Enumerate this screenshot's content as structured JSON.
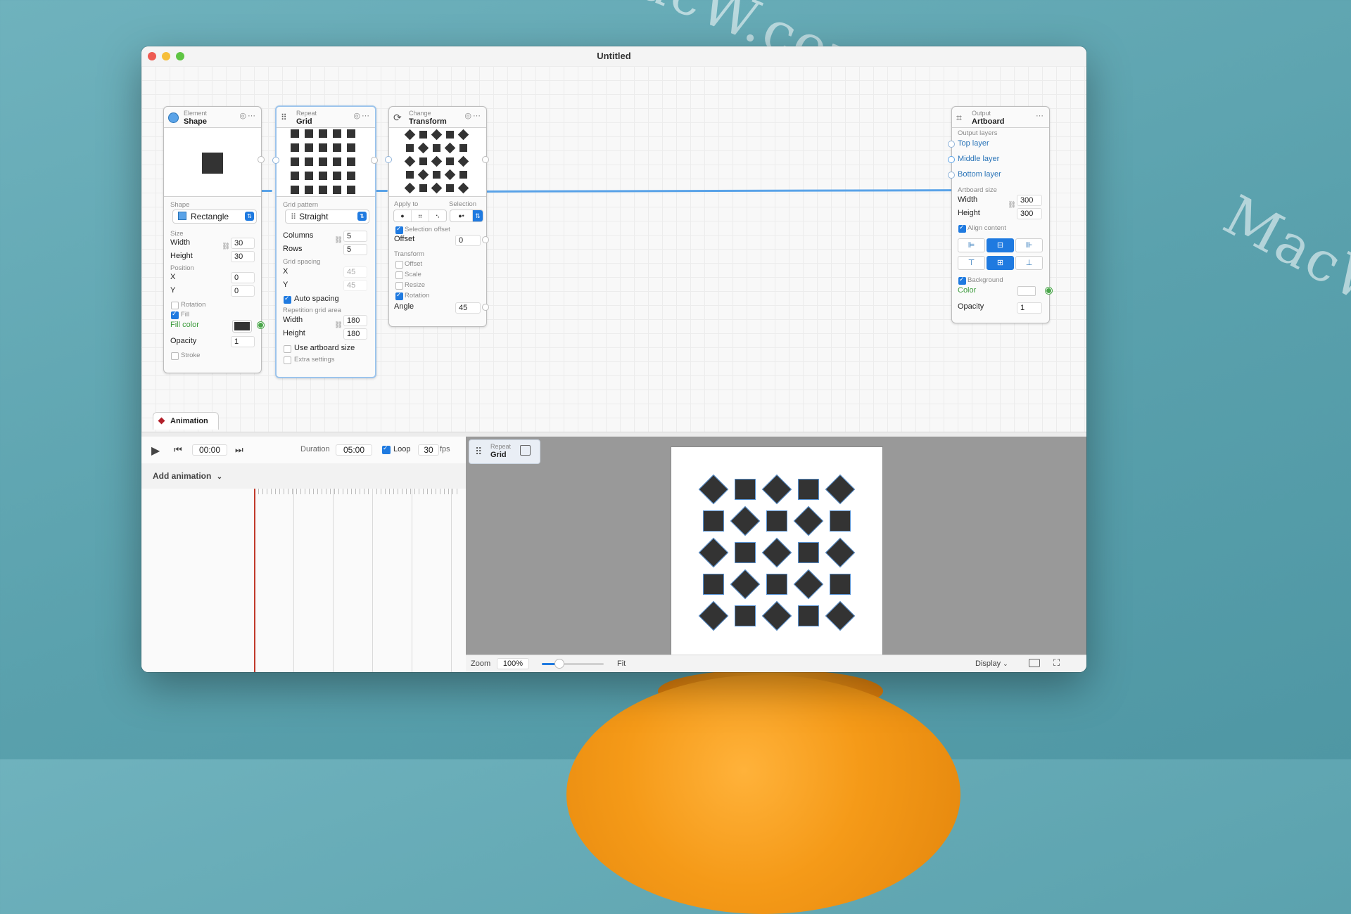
{
  "watermark": "MacW.com",
  "window": {
    "title": "Untitled"
  },
  "nodes": {
    "shape": {
      "category": "Element",
      "name": "Shape",
      "shape_label": "Shape",
      "shape_value": "Rectangle",
      "size_label": "Size",
      "width_label": "Width",
      "width_value": "30",
      "height_label": "Height",
      "height_value": "30",
      "position_label": "Position",
      "x_label": "X",
      "x_value": "0",
      "y_label": "Y",
      "y_value": "0",
      "rotation_label": "Rotation",
      "fill_label": "Fill",
      "fill_color_label": "Fill color",
      "fill_color": "#333333",
      "opacity_label": "Opacity",
      "opacity_value": "1",
      "stroke_label": "Stroke"
    },
    "grid": {
      "category": "Repeat",
      "name": "Grid",
      "pattern_label": "Grid pattern",
      "pattern_value": "Straight",
      "columns_label": "Columns",
      "columns_value": "5",
      "rows_label": "Rows",
      "rows_value": "5",
      "spacing_label": "Grid spacing",
      "x_label": "X",
      "x_value": "45",
      "y_label": "Y",
      "y_value": "45",
      "auto_spacing_label": "Auto spacing",
      "area_label": "Repetition grid area",
      "width_label": "Width",
      "width_value": "180",
      "height_label": "Height",
      "height_value": "180",
      "use_artboard_label": "Use artboard size",
      "extra_label": "Extra settings"
    },
    "transform": {
      "category": "Change",
      "name": "Transform",
      "apply_to_label": "Apply to",
      "selection_label": "Selection",
      "selection_offset_label": "Selection offset",
      "offset_label": "Offset",
      "offset_value": "0",
      "transform_label": "Transform",
      "t_offset_label": "Offset",
      "t_scale_label": "Scale",
      "t_resize_label": "Resize",
      "t_rotation_label": "Rotation",
      "angle_label": "Angle",
      "angle_value": "45"
    },
    "artboard": {
      "category": "Output",
      "name": "Artboard",
      "layers_label": "Output layers",
      "layers": [
        "Top layer",
        "Middle layer",
        "Bottom layer"
      ],
      "size_label": "Artboard size",
      "width_label": "Width",
      "width_value": "300",
      "height_label": "Height",
      "height_value": "300",
      "align_label": "Align content",
      "background_label": "Background",
      "color_label": "Color",
      "opacity_label": "Opacity",
      "opacity_value": "1"
    }
  },
  "animation": {
    "tab_label": "Animation",
    "time": "00:00",
    "duration_label": "Duration",
    "duration_value": "05:00",
    "loop_label": "Loop",
    "fps_value": "30",
    "fps_label": "fps",
    "add_label": "Add animation"
  },
  "preview": {
    "badge_category": "Repeat",
    "badge_name": "Grid",
    "zoom_label": "Zoom",
    "zoom_value": "100%",
    "zoom_fraction": 0.28,
    "fit_label": "Fit",
    "display_label": "Display"
  },
  "colors": {
    "accent": "#1f7ae0",
    "connection": "#5aa3e8",
    "playhead": "#c0392b",
    "fill": "#333333"
  }
}
